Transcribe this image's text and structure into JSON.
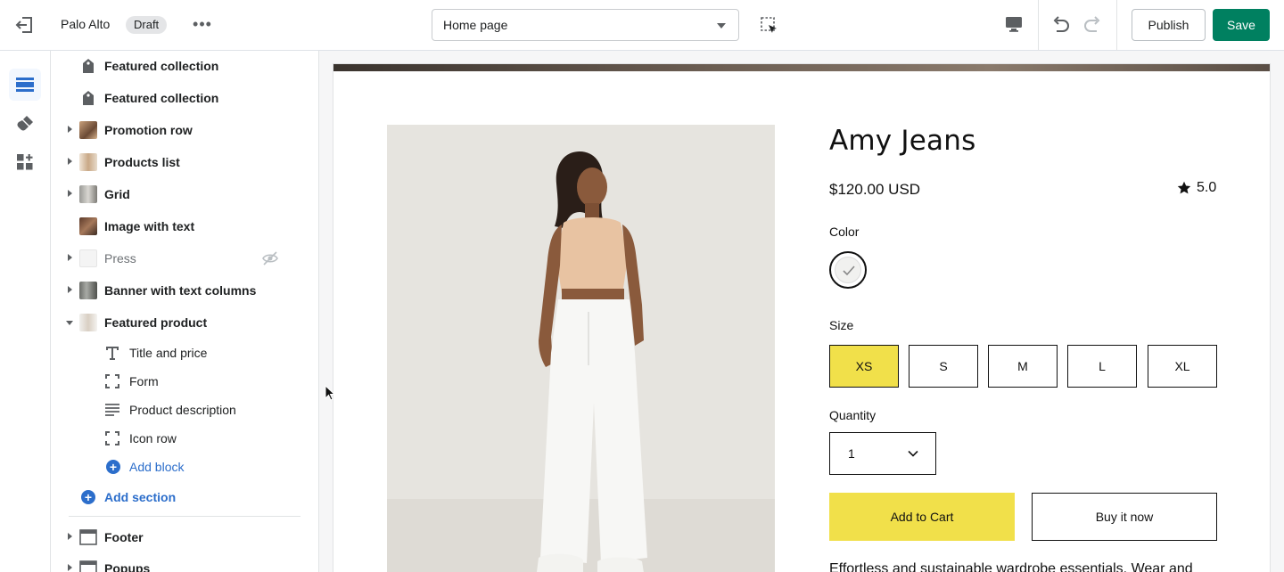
{
  "topbar": {
    "store_name": "Palo Alto",
    "status_badge": "Draft",
    "more_label": "•••",
    "page_select": "Home page",
    "publish_label": "Publish",
    "save_label": "Save"
  },
  "colors": {
    "save": "#008060",
    "accent_link": "#2c6ecb",
    "product_highlight": "#f1e04a"
  },
  "rail": {
    "items": [
      {
        "icon": "sections-icon",
        "active": true
      },
      {
        "icon": "theme-settings-brush-icon",
        "active": false
      },
      {
        "icon": "apps-icon",
        "active": false
      }
    ]
  },
  "sidebar": {
    "sections": [
      {
        "label": "Featured collection",
        "icon": "collection-tag-icon"
      },
      {
        "label": "Featured collection",
        "icon": "collection-tag-icon"
      },
      {
        "label": "Promotion row",
        "icon": "thumbnail"
      },
      {
        "label": "Products list",
        "icon": "thumbnail"
      },
      {
        "label": "Grid",
        "icon": "thumbnail"
      },
      {
        "label": "Image with text",
        "icon": "thumbnail"
      },
      {
        "label": "Press",
        "icon": "thumbnail",
        "hidden": true
      },
      {
        "label": "Banner with text columns",
        "icon": "thumbnail"
      },
      {
        "label": "Featured product",
        "icon": "thumbnail",
        "expanded": true
      }
    ],
    "blocks": [
      {
        "label": "Title and price",
        "icon": "text-icon"
      },
      {
        "label": "Form",
        "icon": "frame-icon"
      },
      {
        "label": "Product description",
        "icon": "paragraph-icon"
      },
      {
        "label": "Icon row",
        "icon": "frame-icon"
      }
    ],
    "add_block": "Add block",
    "add_section": "Add section",
    "footer_sections": [
      {
        "label": "Footer"
      },
      {
        "label": "Popups"
      }
    ]
  },
  "product": {
    "title": "Amy Jeans",
    "price": "$120.00 USD",
    "rating": "5.0",
    "color_label": "Color",
    "size_label": "Size",
    "sizes": [
      "XS",
      "S",
      "M",
      "L",
      "XL"
    ],
    "selected_size": "XS",
    "quantity_label": "Quantity",
    "quantity": "1",
    "add_to_cart": "Add to Cart",
    "buy_now": "Buy it now",
    "description": "Effortless and sustainable wardrobe essentials. Wear and"
  }
}
